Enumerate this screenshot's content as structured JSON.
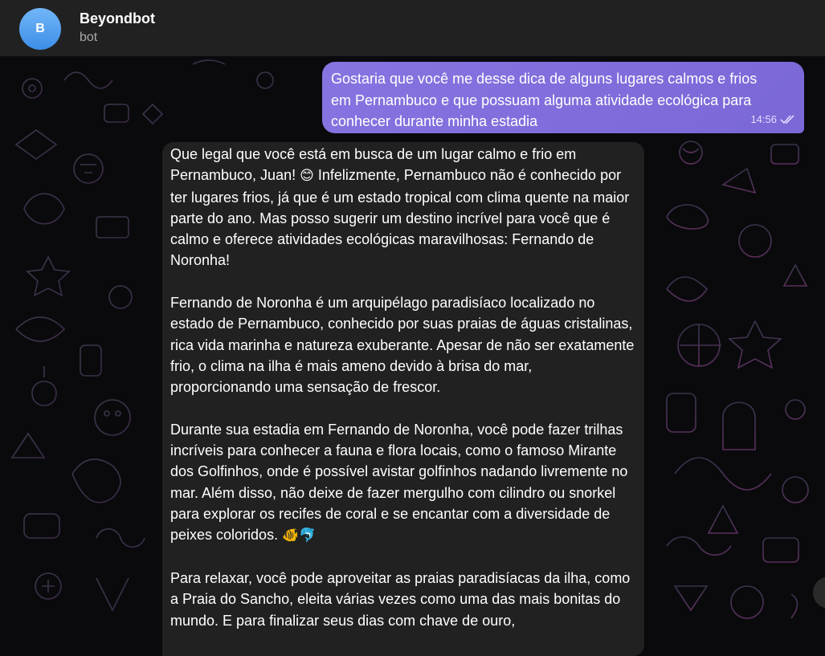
{
  "header": {
    "avatar_initial": "B",
    "title": "Beyondbot",
    "subtitle": "bot"
  },
  "messages": {
    "outgoing": {
      "text": "Gostaria que você me desse dica de alguns lugares calmos e frios em Pernambuco e que possuam alguma atividade ecológica para conhecer durante minha estadia",
      "time": "14:56",
      "status_icon": "double-check-icon"
    },
    "incoming": {
      "p1_text": "Que legal que você está em busca de um lugar calmo e frio em Pernambuco, Juan! ",
      "p1_emoji": "😊",
      "p1_rest": " Infelizmente, Pernambuco não é conhecido por ter lugares frios, já que é um estado tropical com clima quente na maior parte do ano. Mas posso sugerir um destino incrível para você que é calmo e oferece atividades ecológicas maravilhosas: Fernando de Noronha!",
      "p2": "Fernando de Noronha é um arquipélago paradisíaco localizado no estado de Pernambuco, conhecido por suas praias de águas cristalinas, rica vida marinha e natureza exuberante. Apesar de não ser exatamente frio, o clima na ilha é mais ameno devido à brisa do mar, proporcionando uma sensação de frescor.",
      "p3_text": "Durante sua estadia em Fernando de Noronha, você pode fazer trilhas incríveis para conhecer a fauna e flora locais, como o famoso Mirante dos Golfinhos, onde é possível avistar golfinhos nadando livremente no mar. Além disso, não deixe de fazer mergulho com cilindro ou snorkel para explorar os recifes de coral e se encantar com a diversidade de peixes coloridos. ",
      "p3_emoji": "🐠🐬",
      "p4": "Para relaxar, você pode aproveitar as praias paradisíacas da ilha, como a Praia do Sancho, eleita várias vezes como uma das mais bonitas do mundo. E para finalizar seus dias com chave de ouro,"
    }
  },
  "colors": {
    "header_bg": "#212121",
    "outgoing_bubble": "#8774e1",
    "incoming_bubble": "#212121",
    "chat_bg": "#0a0a0d",
    "avatar": "#5aa3f0"
  }
}
